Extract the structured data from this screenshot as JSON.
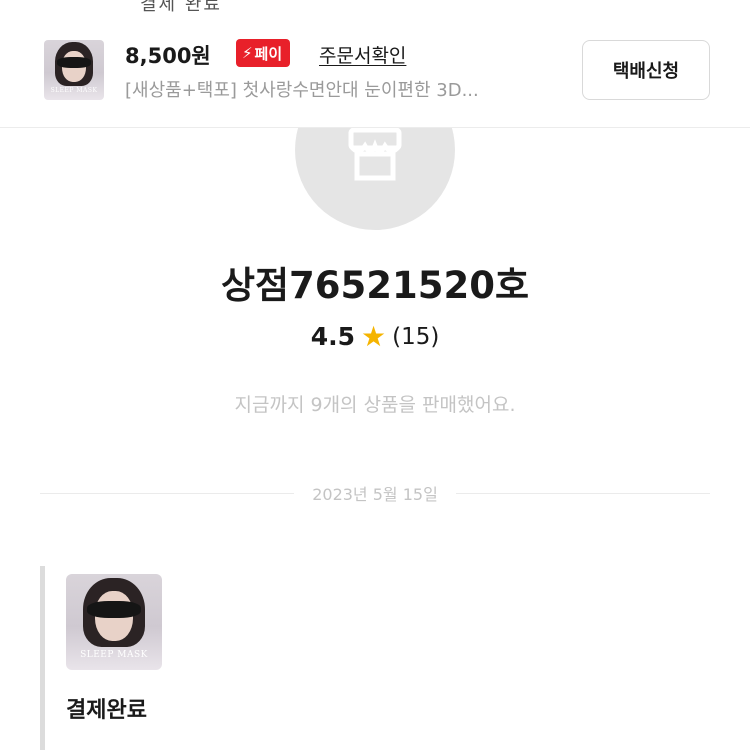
{
  "top_strip": {
    "text": "결제 완료"
  },
  "product": {
    "price": "8,500원",
    "pay_badge": "페이",
    "pay_icon": "lightning-icon",
    "order_link": "주문서확인",
    "title": "[새상품+택포] 첫사랑수면안대 눈이편한 3D...",
    "thumb_label": "SLEEP MASK",
    "ship_button": "택배신청",
    "badge_color": "#e8202a"
  },
  "shop": {
    "name": "상점76521520호",
    "rating": "4.5",
    "review_count": "(15)",
    "summary": "지금까지 9개의 상품을 판매했어요.",
    "avatar_icon": "store-icon",
    "star_color": "#f5b400"
  },
  "chat": {
    "date": "2023년 5월 15일",
    "card": {
      "thumb_label": "SLEEP MASK",
      "status": "결제완료"
    }
  }
}
